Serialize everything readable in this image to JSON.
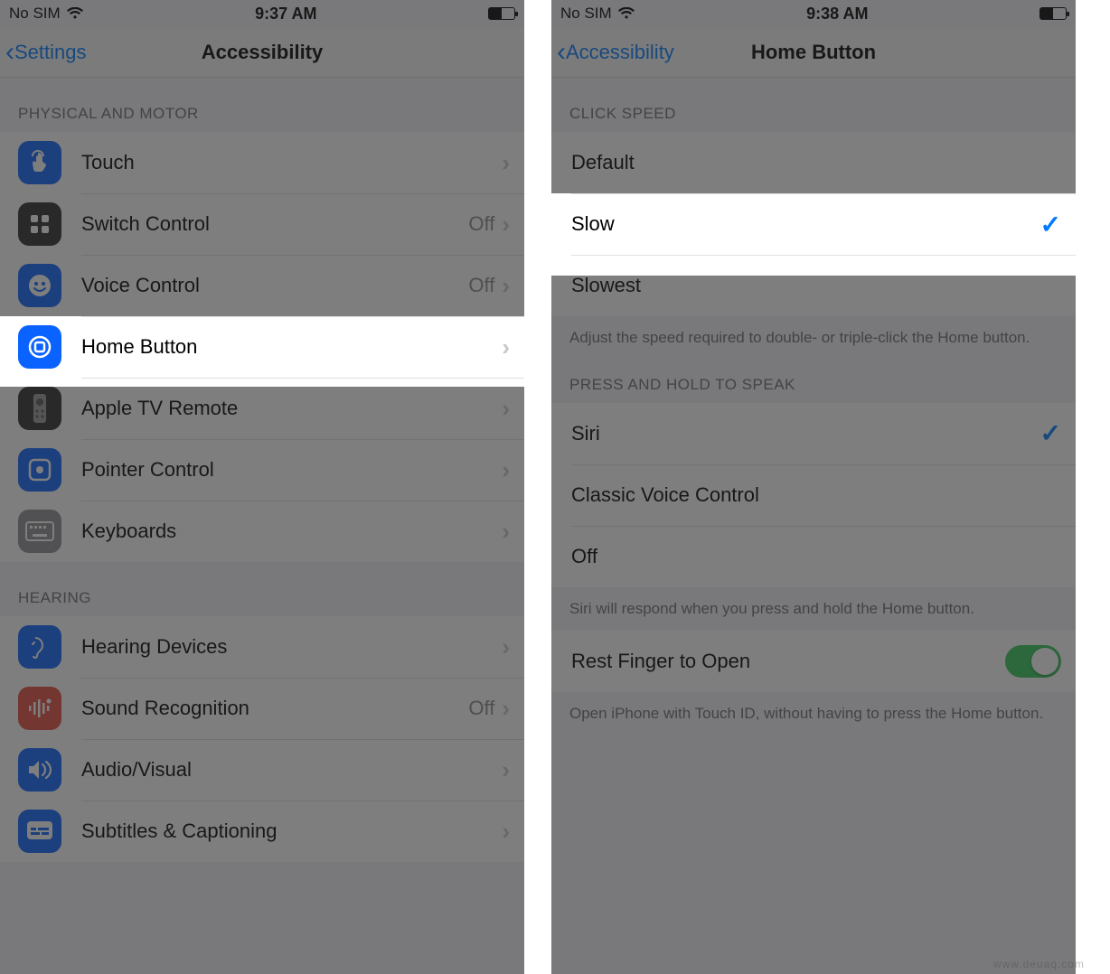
{
  "left": {
    "status": {
      "carrier": "No SIM",
      "time": "9:37 AM"
    },
    "nav": {
      "back": "Settings",
      "title": "Accessibility"
    },
    "section1_header": "PHYSICAL AND MOTOR",
    "rows1": [
      {
        "label": "Touch",
        "detail": "",
        "icon": "touch-icon"
      },
      {
        "label": "Switch Control",
        "detail": "Off",
        "icon": "switch-control-icon"
      },
      {
        "label": "Voice Control",
        "detail": "Off",
        "icon": "voice-control-icon"
      },
      {
        "label": "Home Button",
        "detail": "",
        "icon": "home-button-icon"
      },
      {
        "label": "Apple TV Remote",
        "detail": "",
        "icon": "apple-tv-remote-icon"
      },
      {
        "label": "Pointer Control",
        "detail": "",
        "icon": "pointer-control-icon"
      },
      {
        "label": "Keyboards",
        "detail": "",
        "icon": "keyboards-icon"
      }
    ],
    "section2_header": "HEARING",
    "rows2": [
      {
        "label": "Hearing Devices",
        "detail": "",
        "icon": "hearing-devices-icon"
      },
      {
        "label": "Sound Recognition",
        "detail": "Off",
        "icon": "sound-recognition-icon"
      },
      {
        "label": "Audio/Visual",
        "detail": "",
        "icon": "audio-visual-icon"
      },
      {
        "label": "Subtitles & Captioning",
        "detail": "",
        "icon": "subtitles-icon"
      }
    ]
  },
  "right": {
    "status": {
      "carrier": "No SIM",
      "time": "9:38 AM"
    },
    "nav": {
      "back": "Accessibility",
      "title": "Home Button"
    },
    "click_speed_header": "CLICK SPEED",
    "click_options": [
      {
        "label": "Default",
        "checked": false
      },
      {
        "label": "Slow",
        "checked": true
      },
      {
        "label": "Slowest",
        "checked": false
      }
    ],
    "click_footer": "Adjust the speed required to double- or triple-click the Home button.",
    "speak_header": "PRESS AND HOLD TO SPEAK",
    "speak_options": [
      {
        "label": "Siri",
        "checked": true
      },
      {
        "label": "Classic Voice Control",
        "checked": false
      },
      {
        "label": "Off",
        "checked": false
      }
    ],
    "speak_footer": "Siri will respond when you press and hold the Home button.",
    "rest_finger": {
      "label": "Rest Finger to Open",
      "on": true
    },
    "rest_footer": "Open iPhone with Touch ID, without having to press the Home button."
  },
  "watermark": "www.deuaq.com"
}
